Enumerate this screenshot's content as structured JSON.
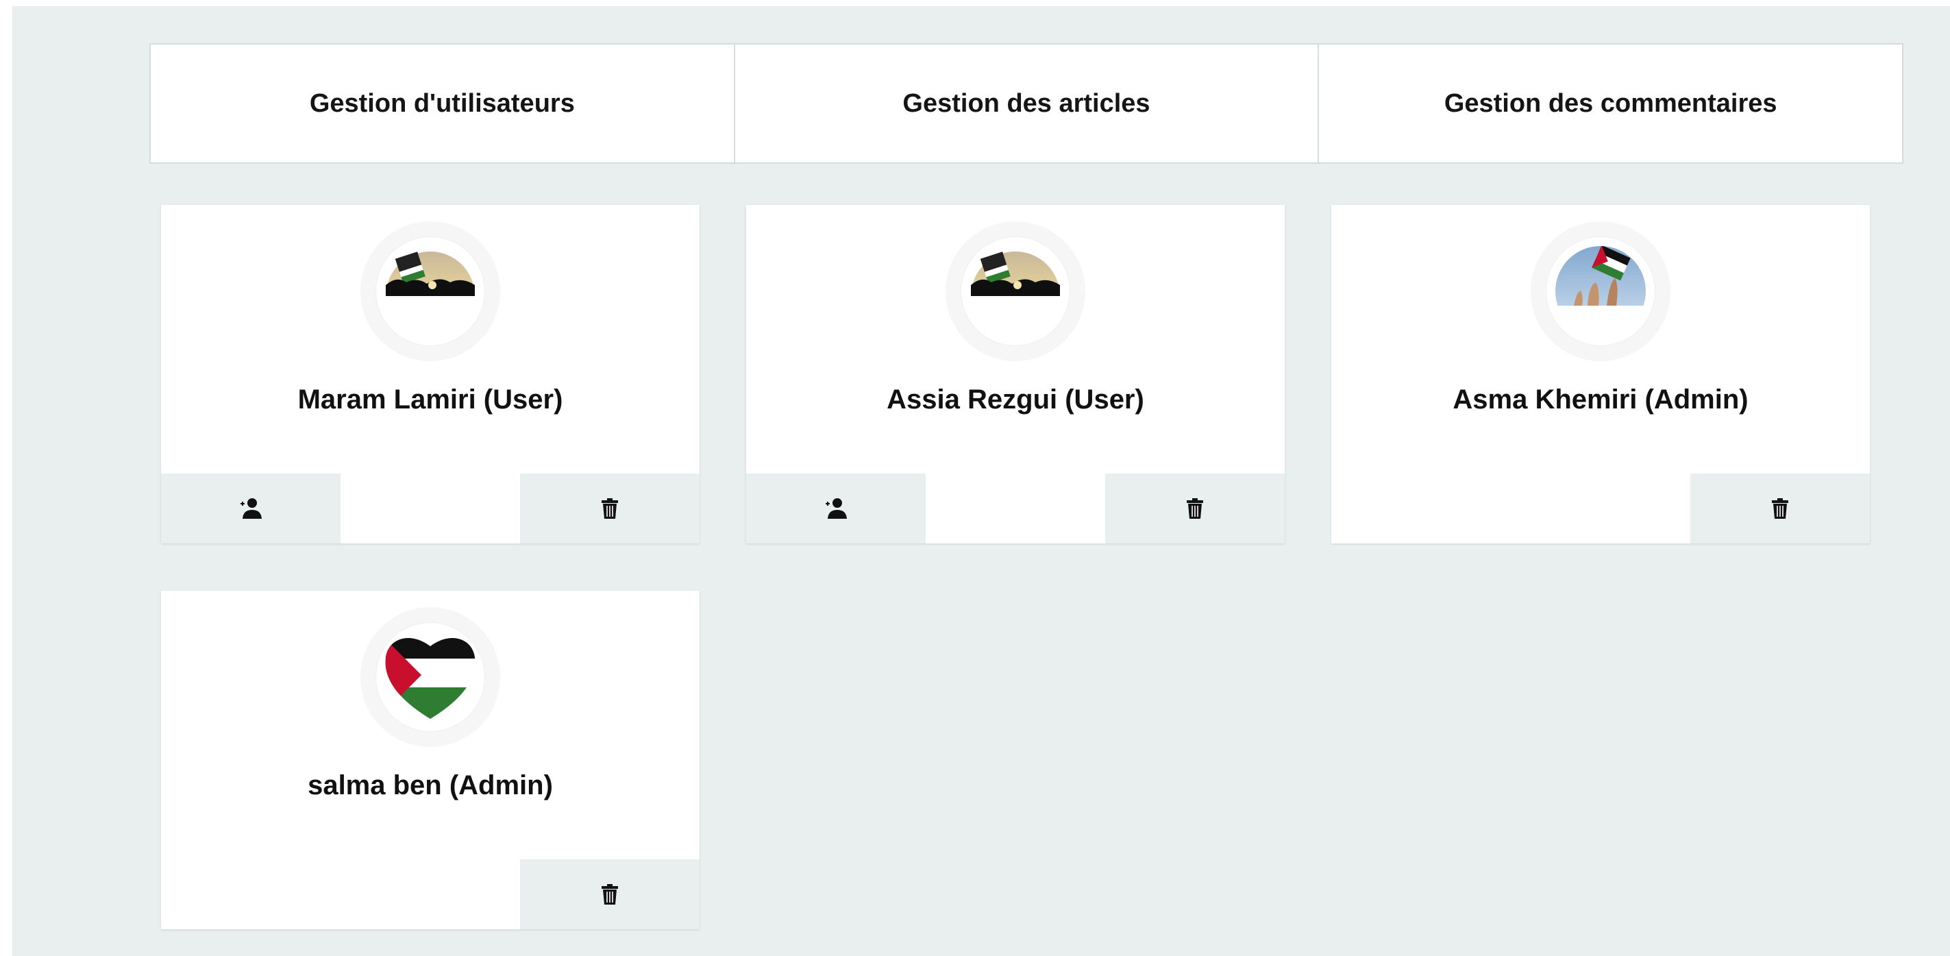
{
  "tabs": [
    {
      "label": "Gestion d'utilisateurs"
    },
    {
      "label": "Gestion des articles"
    },
    {
      "label": "Gestion des commentaires"
    }
  ],
  "users": [
    {
      "name": "Maram Lamiri (User)",
      "avatar_icon": "crowd-flag-photo",
      "actions": [
        "promote-user-icon",
        "trash-icon"
      ]
    },
    {
      "name": "Assia Rezgui (User)",
      "avatar_icon": "crowd-flag-photo",
      "actions": [
        "promote-user-icon",
        "trash-icon"
      ]
    },
    {
      "name": "Asma Khemiri (Admin)",
      "avatar_icon": "raised-flag-photo",
      "actions": [
        "trash-icon"
      ]
    },
    {
      "name": "salma ben (Admin)",
      "avatar_icon": "palestine-heart-flag",
      "actions": [
        "trash-icon"
      ]
    }
  ],
  "colors": {
    "background": "#e9efef",
    "card": "#ffffff",
    "action_bg": "#e9efef",
    "flag_red": "#c8102e",
    "flag_green": "#2e7d32",
    "flag_black": "#111111"
  }
}
